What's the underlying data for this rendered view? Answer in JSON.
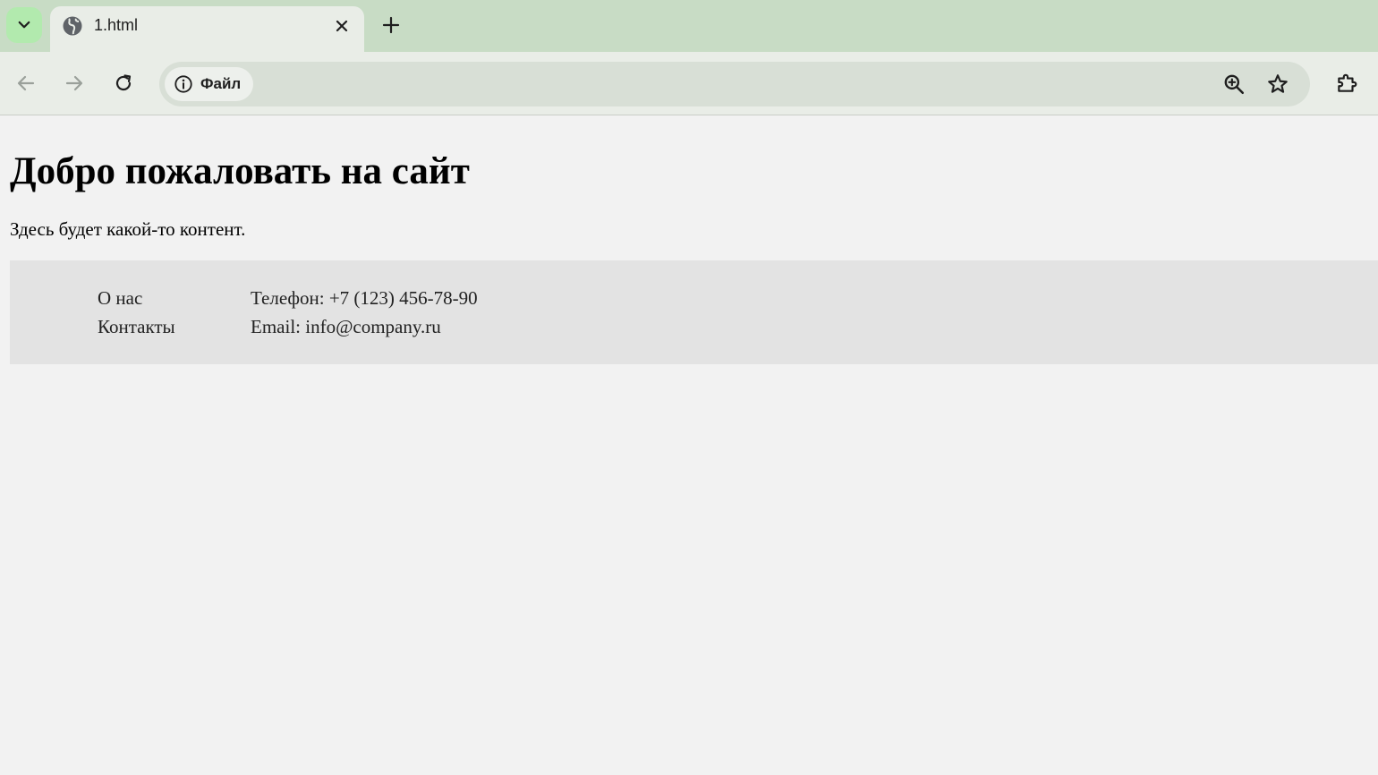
{
  "browser": {
    "tab": {
      "title": "1.html"
    },
    "address_bar": {
      "site_chip_label": "Файл"
    }
  },
  "page": {
    "heading": "Добро пожаловать на сайт",
    "paragraph": "Здесь будет какой-то контент.",
    "footer": {
      "links": [
        "О нас",
        "Контакты"
      ],
      "contacts": [
        "Телефон: +7 (123) 456-78-90",
        "Email: info@company.ru"
      ]
    }
  },
  "colors": {
    "tabstrip": "#c8dcc5",
    "toolbar": "#e9ede7",
    "omnibox": "#d8dfd6",
    "page_background": "#f2f2f2",
    "footer_background": "#e3e3e3"
  }
}
